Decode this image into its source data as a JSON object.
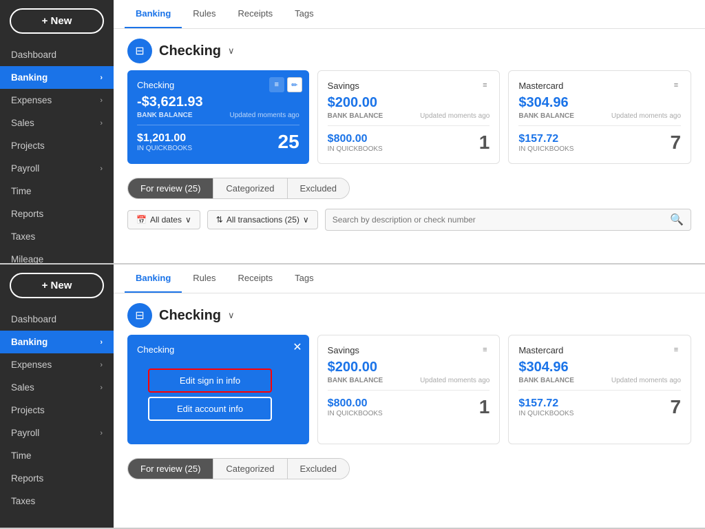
{
  "sidebar": {
    "new_label": "+ New",
    "items": [
      {
        "label": "Dashboard",
        "active": false,
        "has_chevron": false
      },
      {
        "label": "Banking",
        "active": true,
        "has_chevron": true
      },
      {
        "label": "Expenses",
        "active": false,
        "has_chevron": true
      },
      {
        "label": "Sales",
        "active": false,
        "has_chevron": true
      },
      {
        "label": "Projects",
        "active": false,
        "has_chevron": false
      },
      {
        "label": "Payroll",
        "active": false,
        "has_chevron": true
      },
      {
        "label": "Time",
        "active": false,
        "has_chevron": false
      },
      {
        "label": "Reports",
        "active": false,
        "has_chevron": false
      },
      {
        "label": "Taxes",
        "active": false,
        "has_chevron": false
      },
      {
        "label": "Mileage",
        "active": false,
        "has_chevron": false
      }
    ]
  },
  "top_panel": {
    "tabs": [
      "Banking",
      "Rules",
      "Receipts",
      "Tags"
    ],
    "active_tab": "Banking",
    "account_name": "Checking",
    "cards": [
      {
        "id": "checking",
        "title": "Checking",
        "bank_balance": "-$3,621.93",
        "bank_label": "BANK BALANCE",
        "updated": "Updated moments ago",
        "qb_amount": "$1,201.00",
        "qb_label": "IN QUICKBOOKS",
        "count": "25",
        "is_blue": true
      },
      {
        "id": "savings",
        "title": "Savings",
        "bank_balance": "$200.00",
        "bank_label": "BANK BALANCE",
        "updated": "Updated moments ago",
        "qb_amount": "$800.00",
        "qb_label": "IN QUICKBOOKS",
        "count": "1",
        "is_blue": false
      },
      {
        "id": "mastercard",
        "title": "Mastercard",
        "bank_balance": "$304.96",
        "bank_label": "BANK BALANCE",
        "updated": "Updated moments ago",
        "qb_amount": "$157.72",
        "qb_label": "IN QUICKBOOKS",
        "count": "7",
        "is_blue": false
      }
    ],
    "filter_tabs": [
      "For review (25)",
      "Categorized",
      "Excluded"
    ],
    "active_filter": "For review (25)",
    "all_dates_label": "All dates",
    "all_transactions_label": "All transactions (25)",
    "search_placeholder": "Search by description or check number"
  },
  "bottom_panel": {
    "tabs": [
      "Banking",
      "Rules",
      "Receipts",
      "Tags"
    ],
    "active_tab": "Banking",
    "account_name": "Checking",
    "cards": [
      {
        "id": "checking2",
        "title": "Checking",
        "bank_balance": null,
        "bank_label": null,
        "updated": null,
        "qb_amount": null,
        "qb_label": null,
        "count": null,
        "is_blue": true,
        "show_popup": true,
        "edit_sign_in": "Edit sign in info",
        "edit_account": "Edit account info"
      },
      {
        "id": "savings2",
        "title": "Savings",
        "bank_balance": "$200.00",
        "bank_label": "BANK BALANCE",
        "updated": "Updated moments ago",
        "qb_amount": "$800.00",
        "qb_label": "IN QUICKBOOKS",
        "count": "1",
        "is_blue": false
      },
      {
        "id": "mastercard2",
        "title": "Mastercard",
        "bank_balance": "$304.96",
        "bank_label": "BANK BALANCE",
        "updated": "Updated moments ago",
        "qb_amount": "$157.72",
        "qb_label": "IN QUICKBOOKS",
        "count": "7",
        "is_blue": false
      }
    ],
    "filter_tabs": [
      "For review (25)",
      "Categorized",
      "Excluded"
    ],
    "active_filter": "For review (25)"
  }
}
